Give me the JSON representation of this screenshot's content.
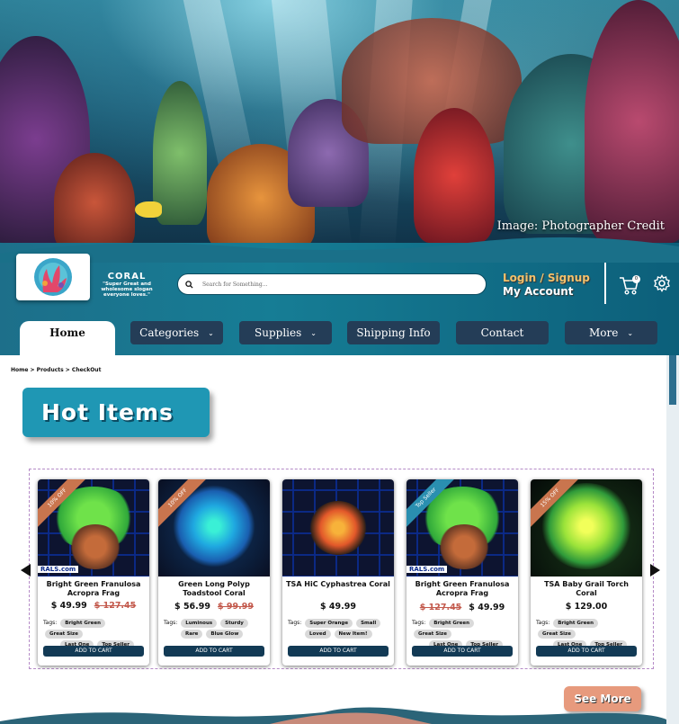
{
  "hero": {
    "credit": "Image: Photographer  Credit"
  },
  "brand": {
    "name": "CORAL",
    "slogan": "\"Super Great and wholesome slogan everyone loves.\""
  },
  "search": {
    "placeholder": "Search for Something..."
  },
  "account": {
    "login": "Login / Signup",
    "my_account": "My Account",
    "cart_count": "0"
  },
  "nav": {
    "home": "Home",
    "items": [
      {
        "label": "Categories",
        "dropdown": true
      },
      {
        "label": "Supplies",
        "dropdown": true
      },
      {
        "label": "Shipping Info",
        "dropdown": false
      },
      {
        "label": "Contact",
        "dropdown": false
      },
      {
        "label": "More",
        "dropdown": true
      }
    ]
  },
  "breadcrumb": "Home > Products > CheckOut",
  "section_title": "Hot Items",
  "products": [
    {
      "ribbon": "10% OFF",
      "watermark": "RALS.com",
      "name": "Bright Green Franulosa Acropra Frag",
      "price": "$ 49.99",
      "old_price": "$ 127.45",
      "tags_label": "Tags:",
      "tags": [
        "Bright Green",
        "Great Size",
        "Last One",
        "Top Seller"
      ],
      "button": "ADD TO CART"
    },
    {
      "ribbon": "10% OFF",
      "watermark": "",
      "name": "Green Long Polyp Toadstool Coral",
      "price": "$ 56.99",
      "old_price": "$ 99.99",
      "tags_label": "Tags:",
      "tags": [
        "Luminous",
        "Sturdy",
        "Rare",
        "Blue Glow"
      ],
      "button": "ADD TO CART"
    },
    {
      "ribbon": "",
      "watermark": "",
      "name": "TSA HiC Cyphastrea Coral",
      "price": "$ 49.99",
      "old_price": "",
      "tags_label": "Tags:",
      "tags": [
        "Super Orange",
        "Small",
        "Loved",
        "New Item!"
      ],
      "button": "ADD TO CART"
    },
    {
      "ribbon": "Top Seller",
      "watermark": "RALS.com",
      "name": "Bright Green Franulosa Acropra Frag",
      "price": "$ 49.99",
      "old_price": "$ 127.45",
      "tags_label": "Tags:",
      "tags": [
        "Bright Green",
        "Great Size",
        "Last One",
        "Top Seller"
      ],
      "button": "ADD TO CART"
    },
    {
      "ribbon": "15% OFF",
      "watermark": "",
      "name": "TSA Baby Grail Torch Coral",
      "price": "$ 129.00",
      "old_price": "",
      "tags_label": "Tags:",
      "tags": [
        "Bright Green",
        "Great Size",
        "Last One",
        "Top Seller"
      ],
      "button": "ADD TO CART"
    }
  ],
  "see_more": "See More",
  "colors": {
    "teal": "#1f97b4",
    "navy": "#243d57",
    "accent_orange": "#e79a7d",
    "gold": "#f4c16b"
  }
}
